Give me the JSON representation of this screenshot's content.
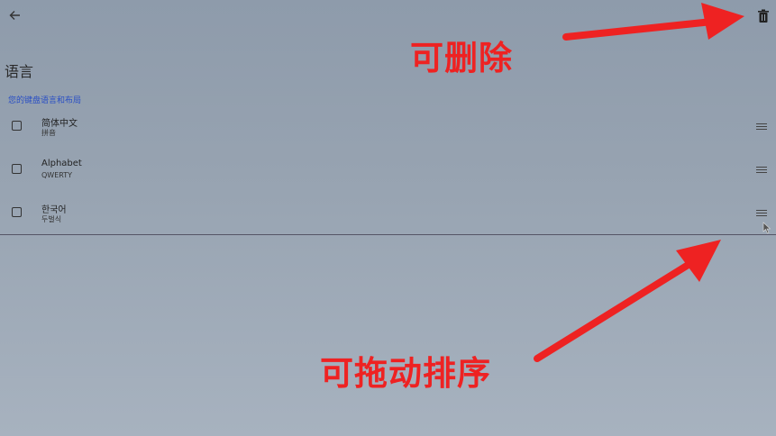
{
  "header": {
    "back_icon": "arrow-left-icon",
    "delete_icon": "trash-icon"
  },
  "page": {
    "title": "语言"
  },
  "section": {
    "label": "您的键盘语言和布局"
  },
  "languages": [
    {
      "name": "简体中文",
      "layout": "拼音"
    },
    {
      "name": "Alphabet",
      "layout": "QWERTY"
    },
    {
      "name": "한국어",
      "layout": "두벌식"
    }
  ],
  "annotations": {
    "delete_hint": "可删除",
    "drag_hint": "可拖动排序",
    "color": "#ee2222"
  }
}
